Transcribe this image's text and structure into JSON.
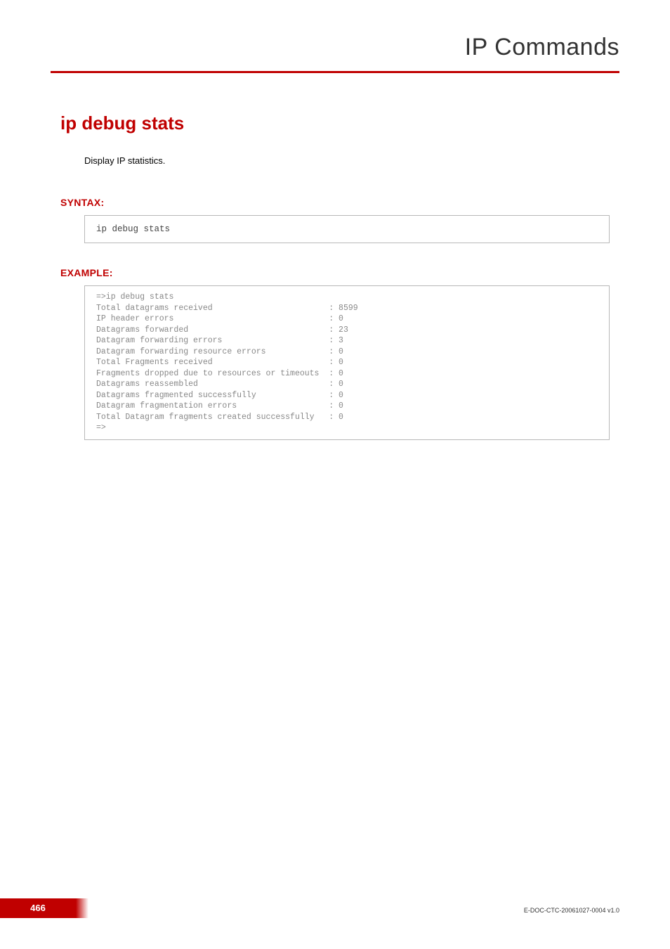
{
  "header": {
    "title": "IP Commands"
  },
  "section": {
    "title": "ip debug stats",
    "description": "Display IP statistics."
  },
  "syntax": {
    "heading": "SYNTAX:",
    "code": "ip debug stats"
  },
  "example": {
    "heading": "EXAMPLE:",
    "text": "=>ip debug stats\nTotal datagrams received                        : 8599\nIP header errors                                : 0\nDatagrams forwarded                             : 23\nDatagram forwarding errors                      : 3\nDatagram forwarding resource errors             : 0\nTotal Fragments received                        : 0\nFragments dropped due to resources or timeouts  : 0\nDatagrams reassembled                           : 0\nDatagrams fragmented successfully               : 0\nDatagram fragmentation errors                   : 0\nTotal Datagram fragments created successfully   : 0\n=>"
  },
  "footer": {
    "page": "466",
    "docid": "E-DOC-CTC-20061027-0004 v1.0"
  }
}
